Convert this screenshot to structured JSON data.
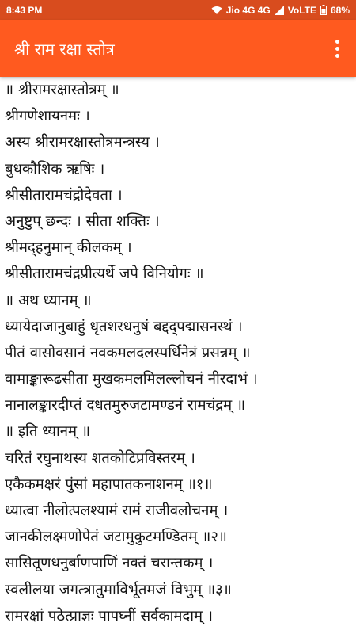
{
  "status_bar": {
    "time": "8:43 PM",
    "network": "Jio 4G 4G",
    "volte": "VoLTE",
    "battery": "68%"
  },
  "app_bar": {
    "title": "श्री राम रक्षा स्तोत्र",
    "menu_icon": "more-vertical-icon"
  },
  "colors": {
    "status_bar": "#d84c1e",
    "app_bar": "#ff5a1f",
    "text": "#111111",
    "background": "#ffffff"
  },
  "content": {
    "lines": [
      "॥ श्रीरामरक्षास्तोत्रम् ॥",
      "श्रीगणेशायनमः ।",
      "अस्य श्रीरामरक्षास्तोत्रमन्त्रस्य ।",
      "बुधकौशिक ऋषिः ।",
      "श्रीसीतारामचंद्रोदेवता ।",
      "अनुष्टुप् छन्दः । सीता शक्तिः ।",
      "श्रीमद्हनुमान् कीलकम् ।",
      "श्रीसीतारामचंद्रप्रीत्यर्थे जपे विनियोगः ॥",
      "॥ अथ ध्यानम् ॥",
      "ध्यायेदाजानुबाहुं धृतशरधनुषं बद्दद्पद्मासनस्थं ।",
      "पीतं वासोवसानं नवकमलदलस्पर्धिनेत्रं प्रसन्नम् ॥",
      "वामाङ्कारूढसीता मुखकमलमिलल्लोचनं नीरदाभं ।",
      "नानालङ्कारदीप्तं दधतमुरुजटामण्डनं रामचंद्रम् ॥",
      "॥ इति ध्यानम् ॥",
      "चरितं रघुनाथस्य शतकोटिप्रविस्तरम् ।",
      "एकैकमक्षरं पुंसां महापातकनाशनम् ॥१॥",
      "ध्यात्वा नीलोत्पलश्यामं रामं राजीवलोचनम् ।",
      "जानकीलक्ष्मणोपेतं जटामुकुटमण्डितम् ॥२॥",
      "सासितूणधनुर्बाणपाणिं नक्तं चरान्तकम् ।",
      "स्वलीलया जगत्त्रातुमाविर्भूतमजं विभुम् ॥३॥",
      "रामरक्षां पठेत्प्राज्ञः पापघ्नीं सर्वकामदाम् ।"
    ]
  }
}
